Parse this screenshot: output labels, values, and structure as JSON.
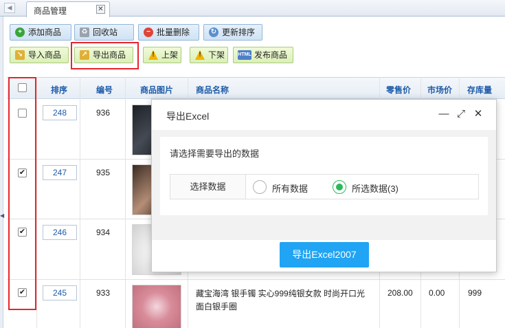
{
  "tabs": {
    "active_label": "商品管理"
  },
  "toolbar": {
    "row1": [
      {
        "label": "添加商品",
        "icon": "add-icon"
      },
      {
        "label": "回收站",
        "icon": "recycle-icon"
      },
      {
        "label": "批量删除",
        "icon": "delete-icon"
      },
      {
        "label": "更新排序",
        "icon": "refresh-icon"
      }
    ],
    "row2": [
      {
        "label": "导入商品",
        "icon": "import-icon"
      },
      {
        "label": "导出商品",
        "icon": "export-icon"
      },
      {
        "label": "上架",
        "icon": "warning-icon"
      },
      {
        "label": "下架",
        "icon": "warning-icon"
      },
      {
        "label": "发布商品",
        "icon": "html-icon"
      }
    ]
  },
  "table": {
    "headers": {
      "sort": "排序",
      "id": "编号",
      "image": "商品图片",
      "name": "商品名称",
      "retail": "零售价",
      "market": "市场价",
      "stock": "存库量"
    },
    "rows": [
      {
        "sort": "248",
        "id": "936",
        "checked": false,
        "name_line1": "",
        "name_line2": "",
        "retail": "",
        "market": "",
        "stock": ""
      },
      {
        "sort": "247",
        "id": "935",
        "checked": true,
        "name_line1": "",
        "name_line2": "",
        "retail": "",
        "market": "",
        "stock": ""
      },
      {
        "sort": "246",
        "id": "934",
        "checked": true,
        "name_line1": "",
        "name_line2": "",
        "retail": "",
        "market": "",
        "stock": ""
      },
      {
        "sort": "245",
        "id": "933",
        "checked": true,
        "name_line1": "藏宝海湾 银手镯 实心999纯银女款 时尚开口光",
        "name_line2": "面白银手圈",
        "retail": "208.00",
        "market": "0.00",
        "stock": "999"
      }
    ]
  },
  "dialog": {
    "title": "导出Excel",
    "prompt": "请选择需要导出的数据",
    "select_label": "选择数据",
    "option_all": "所有数据",
    "option_selected": "所选数据(3)",
    "selected_option": "option_selected",
    "export_button": "导出Excel2007"
  },
  "colors": {
    "highlight": "#e8242a",
    "header_text": "#1d5aa8",
    "primary_button": "#20a4f3",
    "radio_on": "#2db85b"
  }
}
